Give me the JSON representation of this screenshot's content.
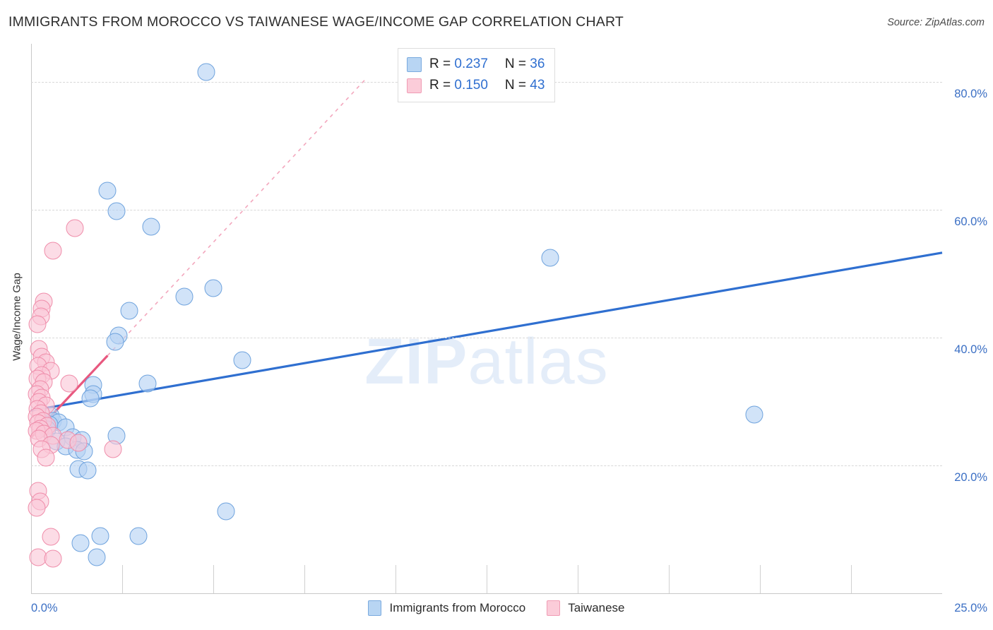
{
  "header": {
    "title": "IMMIGRANTS FROM MOROCCO VS TAIWANESE WAGE/INCOME GAP CORRELATION CHART",
    "source": "Source: ZipAtlas.com"
  },
  "watermark": {
    "part1": "ZIP",
    "part2": "atlas"
  },
  "stats": {
    "rows": [
      {
        "color": "#b8d5f3",
        "r_label": "R = ",
        "r_value": "0.237",
        "n_label": "N = ",
        "n_value": "36"
      },
      {
        "color": "#fbccd9",
        "r_label": "R = ",
        "r_value": "0.150",
        "n_label": "N = ",
        "n_value": "43"
      }
    ]
  },
  "legend": {
    "items": [
      {
        "label": "Immigrants from Morocco",
        "color": "#b8d5f3"
      },
      {
        "label": "Taiwanese",
        "color": "#fbccd9"
      }
    ]
  },
  "axes": {
    "y_title": "Wage/Income Gap",
    "y_ticks": [
      "80.0%",
      "60.0%",
      "40.0%",
      "20.0%"
    ],
    "x_min_label": "0.0%",
    "x_max_label": "25.0%"
  },
  "chart_data": {
    "type": "scatter",
    "title": "IMMIGRANTS FROM MOROCCO VS TAIWANESE WAGE/INCOME GAP CORRELATION CHART",
    "xlabel": "",
    "ylabel": "Wage/Income Gap",
    "xlim": [
      0.0,
      25.0
    ],
    "ylim": [
      0.0,
      86.0
    ],
    "x_unit": "%",
    "y_unit": "%",
    "y_gridlines": [
      20.0,
      40.0,
      60.0,
      80.0
    ],
    "grid": true,
    "legend_position": "bottom-center",
    "series": [
      {
        "name": "Immigrants from Morocco",
        "color": "#b8d5f3",
        "border_color": "#6fa3dd",
        "R": 0.237,
        "N": 36,
        "trend": {
          "x0": 0.0,
          "y0": 28.6,
          "x1": 25.0,
          "y1": 53.3,
          "color": "#2f6fd0",
          "style": "solid"
        },
        "points": [
          {
            "x": 4.8,
            "y": 81.6
          },
          {
            "x": 2.1,
            "y": 63.0
          },
          {
            "x": 2.35,
            "y": 59.8
          },
          {
            "x": 3.3,
            "y": 57.4
          },
          {
            "x": 14.25,
            "y": 52.5
          },
          {
            "x": 5.0,
            "y": 47.8
          },
          {
            "x": 4.2,
            "y": 46.4
          },
          {
            "x": 2.7,
            "y": 44.2
          },
          {
            "x": 2.4,
            "y": 40.4
          },
          {
            "x": 2.3,
            "y": 39.4
          },
          {
            "x": 5.8,
            "y": 36.5
          },
          {
            "x": 3.2,
            "y": 32.8
          },
          {
            "x": 1.7,
            "y": 32.6
          },
          {
            "x": 1.7,
            "y": 31.2
          },
          {
            "x": 1.62,
            "y": 30.5
          },
          {
            "x": 19.85,
            "y": 28.0
          },
          {
            "x": 0.55,
            "y": 27.8
          },
          {
            "x": 0.6,
            "y": 27.0
          },
          {
            "x": 0.75,
            "y": 26.8
          },
          {
            "x": 0.5,
            "y": 26.4
          },
          {
            "x": 0.95,
            "y": 26.0
          },
          {
            "x": 0.45,
            "y": 25.6
          },
          {
            "x": 2.35,
            "y": 24.6
          },
          {
            "x": 1.15,
            "y": 24.4
          },
          {
            "x": 1.4,
            "y": 24.0
          },
          {
            "x": 0.7,
            "y": 23.8
          },
          {
            "x": 0.95,
            "y": 23.0
          },
          {
            "x": 1.25,
            "y": 22.4
          },
          {
            "x": 1.45,
            "y": 22.2
          },
          {
            "x": 1.3,
            "y": 19.4
          },
          {
            "x": 1.55,
            "y": 19.2
          },
          {
            "x": 5.35,
            "y": 12.8
          },
          {
            "x": 1.9,
            "y": 9.0
          },
          {
            "x": 2.95,
            "y": 9.0
          },
          {
            "x": 1.8,
            "y": 5.6
          },
          {
            "x": 1.35,
            "y": 7.8
          }
        ]
      },
      {
        "name": "Taiwanese",
        "color": "#fbccd9",
        "border_color": "#ef8daa",
        "R": 0.15,
        "N": 43,
        "trend": {
          "x0": 0.0,
          "y0": 24.4,
          "x1": 2.1,
          "y1": 37.2,
          "color": "#e8587f",
          "style": "solid"
        },
        "trend_extension": {
          "x0": 2.1,
          "y0": 37.2,
          "x1": 9.2,
          "y1": 80.6,
          "color": "#f3a7bd",
          "style": "dashed"
        },
        "points": [
          {
            "x": 1.2,
            "y": 57.2
          },
          {
            "x": 0.6,
            "y": 53.6
          },
          {
            "x": 0.35,
            "y": 45.6
          },
          {
            "x": 0.3,
            "y": 44.6
          },
          {
            "x": 0.28,
            "y": 43.3
          },
          {
            "x": 0.18,
            "y": 42.1
          },
          {
            "x": 0.22,
            "y": 38.2
          },
          {
            "x": 0.3,
            "y": 37.0
          },
          {
            "x": 0.4,
            "y": 36.2
          },
          {
            "x": 0.2,
            "y": 35.6
          },
          {
            "x": 0.55,
            "y": 34.8
          },
          {
            "x": 0.3,
            "y": 34.2
          },
          {
            "x": 0.18,
            "y": 33.6
          },
          {
            "x": 0.35,
            "y": 33.0
          },
          {
            "x": 1.05,
            "y": 32.8
          },
          {
            "x": 0.25,
            "y": 32.0
          },
          {
            "x": 0.15,
            "y": 31.2
          },
          {
            "x": 0.3,
            "y": 30.6
          },
          {
            "x": 0.22,
            "y": 30.0
          },
          {
            "x": 0.4,
            "y": 29.4
          },
          {
            "x": 0.18,
            "y": 28.8
          },
          {
            "x": 0.28,
            "y": 28.2
          },
          {
            "x": 0.15,
            "y": 27.6
          },
          {
            "x": 0.32,
            "y": 27.0
          },
          {
            "x": 0.2,
            "y": 26.6
          },
          {
            "x": 0.45,
            "y": 26.2
          },
          {
            "x": 0.25,
            "y": 25.8
          },
          {
            "x": 0.15,
            "y": 25.4
          },
          {
            "x": 0.35,
            "y": 25.0
          },
          {
            "x": 0.6,
            "y": 24.6
          },
          {
            "x": 0.22,
            "y": 24.2
          },
          {
            "x": 1.0,
            "y": 24.0
          },
          {
            "x": 1.3,
            "y": 23.6
          },
          {
            "x": 0.55,
            "y": 23.2
          },
          {
            "x": 0.3,
            "y": 22.6
          },
          {
            "x": 2.25,
            "y": 22.6
          },
          {
            "x": 0.4,
            "y": 21.2
          },
          {
            "x": 0.2,
            "y": 16.0
          },
          {
            "x": 0.25,
            "y": 14.4
          },
          {
            "x": 0.15,
            "y": 13.4
          },
          {
            "x": 0.55,
            "y": 8.8
          },
          {
            "x": 0.2,
            "y": 5.6
          },
          {
            "x": 0.6,
            "y": 5.4
          }
        ]
      }
    ]
  }
}
